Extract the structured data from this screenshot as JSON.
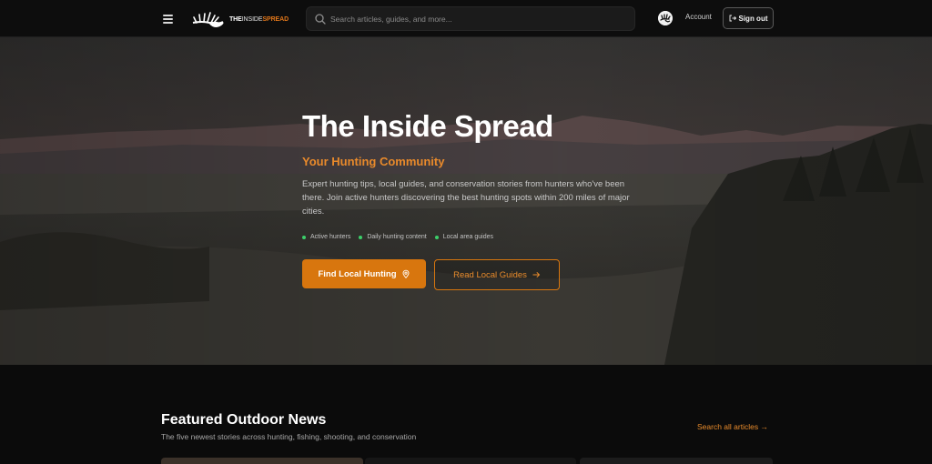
{
  "header": {
    "logo": {
      "text_main": "THE",
      "text_thin": "INSIDE",
      "text_accent": "SPREAD"
    },
    "search": {
      "placeholder": "Search articles, guides, and more..."
    },
    "account_label": "Account",
    "signout_label": "Sign out"
  },
  "hero": {
    "title": "The Inside Spread",
    "subtitle": "Your Hunting Community",
    "description": "Expert hunting tips, local guides, and conservation stories from hunters who've been there. Join active hunters discovering the best hunting spots within 200 miles of major cities.",
    "points": [
      "Active hunters",
      "Daily hunting content",
      "Local area guides"
    ],
    "primary_button": "Find Local Hunting",
    "secondary_button": "Read Local Guides"
  },
  "featured": {
    "title": "Featured Outdoor News",
    "subtitle": "The five newest stories across hunting, fishing, shooting, and conservation",
    "search_all": "Search all articles"
  },
  "colors": {
    "accent": "#d8760e",
    "accent_text": "#ea8c2c",
    "status_dot": "#3ccf6a",
    "background": "#0b0b0b"
  },
  "icons": [
    "menu-icon",
    "elk-antler-logo-icon",
    "search-icon",
    "user-avatar-icon",
    "sign-out-icon",
    "map-pin-icon",
    "arrow-right-icon"
  ]
}
